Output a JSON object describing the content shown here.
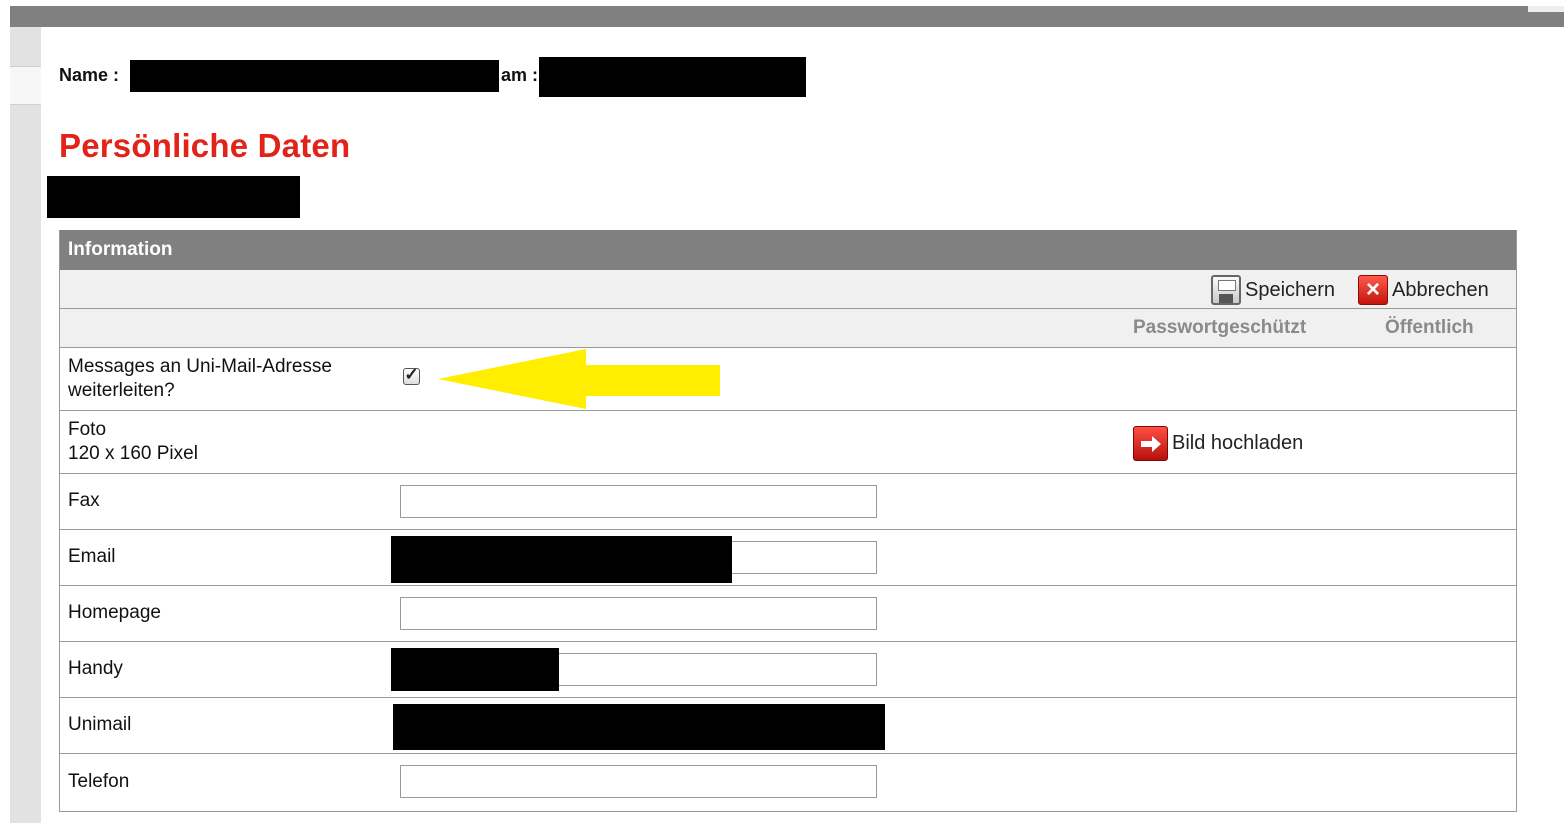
{
  "profile": {
    "name_label": "Name :",
    "am_label": "am :"
  },
  "page_title": "Persönliche Daten",
  "panel": {
    "header": "Information",
    "toolbar": {
      "save_label": "Speichern",
      "cancel_label": "Abbrechen",
      "save_icon": "save-icon",
      "cancel_icon": "close-icon"
    },
    "columns": {
      "password_protected": "Passwortgeschützt",
      "public": "Öffentlich"
    },
    "rows": {
      "messages": {
        "label_line1": "Messages an Uni-Mail-Adresse",
        "label_line2": "weiterleiten?",
        "checked": true
      },
      "foto": {
        "label_line1": "Foto",
        "label_line2": "120 x 160 Pixel",
        "upload_label": "Bild hochladen",
        "upload_icon": "arrow-right-icon"
      },
      "fax": {
        "label": "Fax",
        "value": ""
      },
      "email": {
        "label": "Email",
        "value": ""
      },
      "homepage": {
        "label": "Homepage",
        "value": ""
      },
      "handy": {
        "label": "Handy",
        "value": ""
      },
      "unimail": {
        "label": "Unimail",
        "value": ""
      },
      "telefon": {
        "label": "Telefon",
        "value": ""
      }
    }
  },
  "colors": {
    "title_red": "#e2231a",
    "header_gray": "#808080",
    "annotation_yellow": "#ffee00",
    "redaction": "#000000"
  }
}
